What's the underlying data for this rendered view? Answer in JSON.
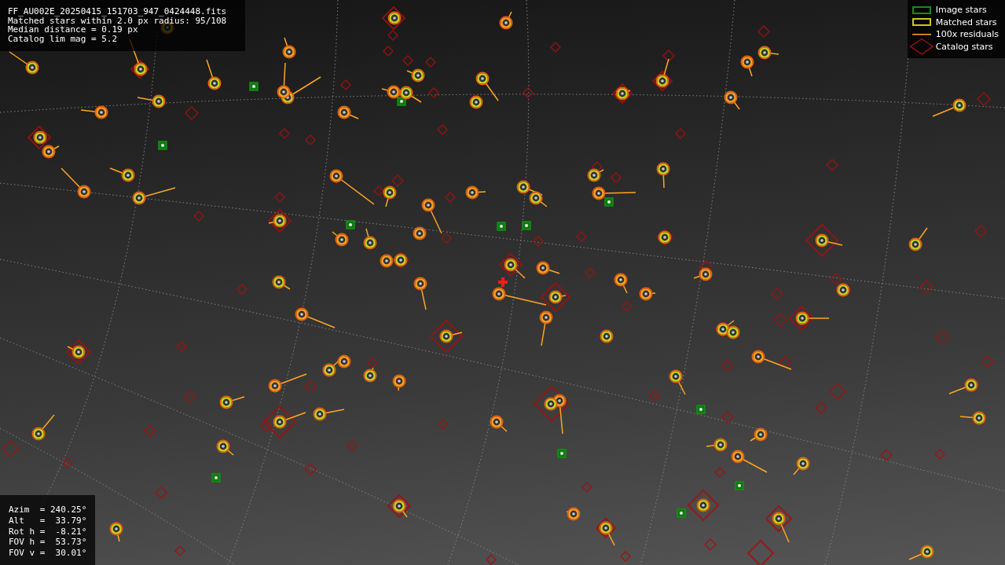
{
  "info_panel": {
    "lines": [
      "FF_AU002E_20250415_151703_947_0424448.fits",
      "Matched stars within 2.0 px radius: 95/108",
      "Median distance = 0.19 px",
      "Catalog lim mag = 5.2"
    ]
  },
  "legend": [
    {
      "kind": "image",
      "label": "Image stars"
    },
    {
      "kind": "matched",
      "label": "Matched stars"
    },
    {
      "kind": "residual",
      "label": "100x residuals"
    },
    {
      "kind": "catalog",
      "label": "Catalog stars"
    }
  ],
  "pointing_panel": {
    "lines": [
      "Azim  = 240.25°",
      "Alt   =  33.79°",
      "Rot h =  -8.21°",
      "FOV h =  53.73°",
      "FOV v =  30.01°"
    ]
  }
}
